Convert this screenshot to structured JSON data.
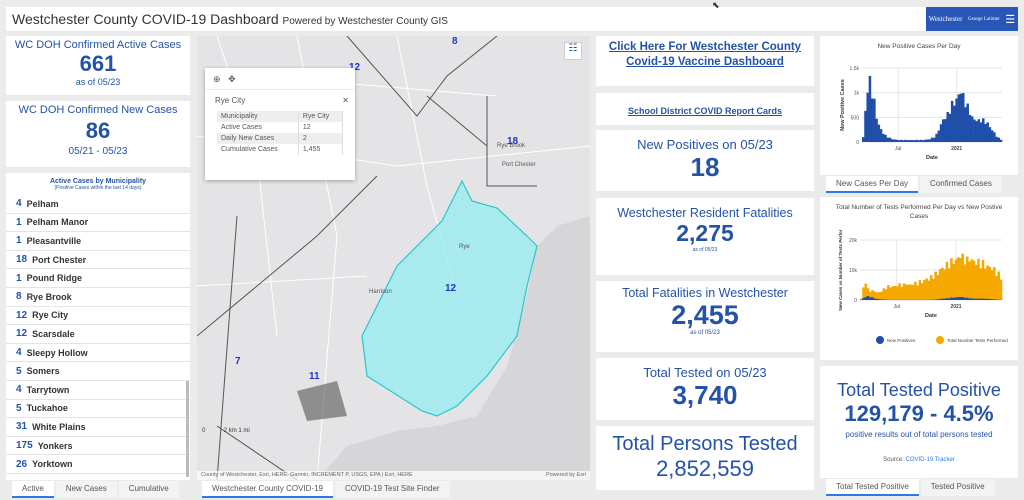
{
  "header": {
    "title": "Westchester County COVID-19 Dashboard",
    "subtitle": "Powered by Westchester County GIS",
    "logo_left": "Westchester gov.com",
    "logo_right": "George Latimer County Executive"
  },
  "active_cases": {
    "title": "WC DOH Confirmed Active Cases",
    "value": "661",
    "date": "as of 05/23"
  },
  "new_cases": {
    "title": "WC DOH Confirmed New Cases",
    "value": "86",
    "date": "05/21 - 05/23"
  },
  "municipality_list": {
    "title": "Active Cases by Municipality",
    "subtitle": "(Positive Cases within the last 14 days)",
    "items": [
      {
        "n": "4",
        "name": "Pelham"
      },
      {
        "n": "1",
        "name": "Pelham Manor"
      },
      {
        "n": "1",
        "name": "Pleasantville"
      },
      {
        "n": "18",
        "name": "Port Chester"
      },
      {
        "n": "1",
        "name": "Pound Ridge"
      },
      {
        "n": "8",
        "name": "Rye Brook"
      },
      {
        "n": "12",
        "name": "Rye City"
      },
      {
        "n": "12",
        "name": "Scarsdale"
      },
      {
        "n": "4",
        "name": "Sleepy Hollow"
      },
      {
        "n": "5",
        "name": "Somers"
      },
      {
        "n": "4",
        "name": "Tarrytown"
      },
      {
        "n": "5",
        "name": "Tuckahoe"
      },
      {
        "n": "31",
        "name": "White Plains"
      },
      {
        "n": "175",
        "name": "Yonkers"
      },
      {
        "n": "26",
        "name": "Yorktown"
      }
    ],
    "tabs": [
      "Active",
      "New Cases",
      "Cumulative"
    ]
  },
  "map": {
    "popup": {
      "title": "Rye City",
      "rows": [
        [
          "Municipality",
          "Rye City"
        ],
        [
          "Active Cases",
          "12"
        ],
        [
          "Daily New Cases",
          "2"
        ],
        [
          "Cumulative Cases",
          "1,455"
        ]
      ]
    },
    "labels": [
      "8",
      "12",
      "18",
      "12",
      "7",
      "11"
    ],
    "places": [
      "Rye Brook",
      "Port Chester",
      "Rye",
      "Harrison"
    ],
    "scale": {
      "km": "2 km",
      "zero": "0",
      "mi": "1 mi"
    },
    "attribution": "County of Westchester, Esri, HERE, Garmin, INCREMENT P, USGS, EPA | Esri, HERE",
    "powered": "Powered by Esri",
    "tabs": [
      "Westchester County COVID-19",
      "COVID-19 Test Site Finder"
    ],
    "highlight_color": "#7fe8ec"
  },
  "middle": {
    "vaccine_link": "Click Here For Westchester County Covid-19 Vaccine Dashboard",
    "school_link": "School District COVID Report Cards",
    "new_positives": {
      "title": "New Positives on 05/23",
      "value": "18"
    },
    "resident_fatalities": {
      "title": "Westchester Resident Fatalities",
      "value": "2,275",
      "date": "as of 05/23"
    },
    "total_fatalities": {
      "title": "Total Fatalities in Westchester",
      "value": "2,455",
      "date": "as of 05/23"
    },
    "total_tested": {
      "title": "Total Tested on 05/23",
      "value": "3,740"
    },
    "persons_tested": {
      "title": "Total Persons Tested",
      "value": "2,852,559"
    }
  },
  "right": {
    "chart_tabs": [
      "New Cases Per Day",
      "Confirmed Cases"
    ],
    "positive": {
      "title": "Total Tested Positive",
      "value": "129,179 - 4.5%",
      "desc": "positive results out of total persons tested",
      "source_label": "Source:",
      "source_link": "COVID-19 Tracker"
    },
    "positive_tabs": [
      "Total Tested Positive",
      "Tested Positive"
    ]
  },
  "colors": {
    "accent": "#2452a8",
    "positives": "#1f4fa8",
    "tests": "#f5a800"
  },
  "chart_data": [
    {
      "type": "bar",
      "title": "New Positive Cases Per Day",
      "xlabel": "Date",
      "ylabel": "New Positive Cases",
      "ylim": [
        0,
        1500
      ],
      "yticks": [
        "0",
        "500",
        "1k",
        "1.5k"
      ],
      "xticks": [
        "Jul",
        "2021"
      ],
      "grid": true,
      "x": [
        "2020-03-09",
        "2020-03-16",
        "2020-03-23",
        "2020-03-30",
        "2020-04-06",
        "2020-04-13",
        "2020-04-20",
        "2020-04-27",
        "2020-05-04",
        "2020-05-11",
        "2020-05-18",
        "2020-05-25",
        "2020-06-01",
        "2020-06-08",
        "2020-06-15",
        "2020-06-22",
        "2020-06-29",
        "2020-07-06",
        "2020-07-13",
        "2020-07-20",
        "2020-07-27",
        "2020-08-03",
        "2020-08-10",
        "2020-08-17",
        "2020-08-24",
        "2020-08-31",
        "2020-09-07",
        "2020-09-14",
        "2020-09-21",
        "2020-09-28",
        "2020-10-05",
        "2020-10-12",
        "2020-10-19",
        "2020-10-26",
        "2020-11-02",
        "2020-11-09",
        "2020-11-16",
        "2020-11-23",
        "2020-11-30",
        "2020-12-07",
        "2020-12-14",
        "2020-12-21",
        "2020-12-28",
        "2021-01-04",
        "2021-01-11",
        "2021-01-18",
        "2021-01-25",
        "2021-02-01",
        "2021-02-08",
        "2021-02-15",
        "2021-02-22",
        "2021-03-01",
        "2021-03-08",
        "2021-03-15",
        "2021-03-22",
        "2021-03-29",
        "2021-04-05",
        "2021-04-12",
        "2021-04-19",
        "2021-04-26",
        "2021-05-03",
        "2021-05-10",
        "2021-05-17"
      ],
      "values": [
        100,
        600,
        1100,
        1200,
        1000,
        800,
        500,
        350,
        250,
        180,
        130,
        100,
        80,
        60,
        50,
        45,
        40,
        40,
        40,
        40,
        40,
        40,
        40,
        40,
        40,
        40,
        40,
        40,
        45,
        50,
        60,
        80,
        100,
        150,
        250,
        350,
        450,
        500,
        550,
        650,
        750,
        800,
        850,
        950,
        1050,
        900,
        800,
        700,
        600,
        500,
        450,
        450,
        420,
        450,
        430,
        400,
        380,
        300,
        250,
        180,
        120,
        80,
        50
      ]
    },
    {
      "type": "area",
      "title": "Total Number of Tests Performed Per Day vs New Postive Cases",
      "xlabel": "Date",
      "ylabel": "New Cases vs Number of Tests Perfor",
      "ylim": [
        0,
        20000
      ],
      "yticks": [
        "0",
        "10k",
        "20k"
      ],
      "xticks": [
        "Jul",
        "2021"
      ],
      "grid": true,
      "legend": "bottom",
      "series": [
        {
          "name": "New Positives",
          "values": [
            100,
            600,
            1100,
            1200,
            1000,
            800,
            500,
            350,
            250,
            180,
            130,
            100,
            80,
            60,
            50,
            45,
            40,
            40,
            40,
            40,
            40,
            40,
            40,
            40,
            40,
            40,
            40,
            40,
            45,
            50,
            60,
            80,
            100,
            150,
            250,
            350,
            450,
            500,
            550,
            650,
            750,
            800,
            850,
            950,
            1050,
            900,
            800,
            700,
            600,
            500,
            450,
            450,
            420,
            450,
            430,
            400,
            380,
            300,
            250,
            180,
            120,
            80,
            50
          ]
        },
        {
          "name": "Total Number Tests Performed",
          "values": [
            500,
            4000,
            6000,
            3500,
            3000,
            3000,
            3000,
            2500,
            2500,
            3000,
            3500,
            4000,
            4500,
            4500,
            4500,
            4500,
            5000,
            5000,
            5000,
            5000,
            5500,
            5000,
            5000,
            5500,
            5500,
            5500,
            6000,
            6000,
            6500,
            7000,
            7000,
            7500,
            8000,
            8500,
            9000,
            10000,
            10500,
            11000,
            11500,
            12000,
            12500,
            13000,
            13000,
            14000,
            15000,
            14000,
            13500,
            13000,
            14000,
            13000,
            13000,
            12500,
            12500,
            12000,
            12000,
            11500,
            11000,
            11000,
            10500,
            10000,
            9000,
            8500,
            7500
          ]
        }
      ]
    }
  ]
}
